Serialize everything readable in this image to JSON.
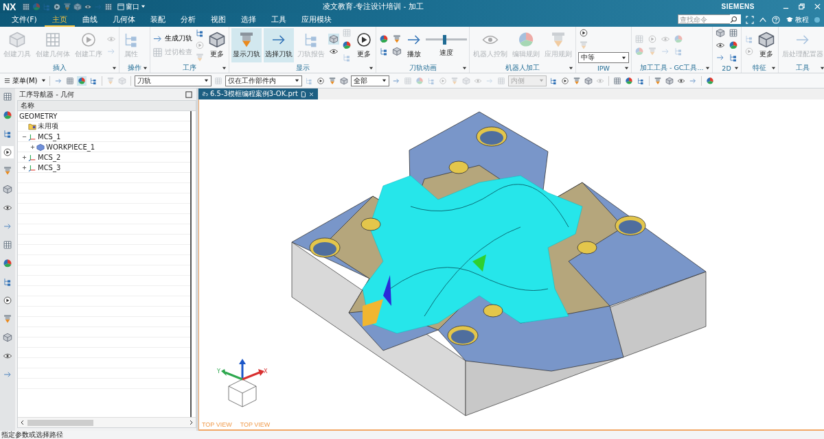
{
  "title_bar": {
    "app": "NX",
    "window_menu": "窗口",
    "title": "凌文教育-专注设计培训 - 加工",
    "brand": "SIEMENS"
  },
  "menu_tabs": [
    {
      "label": "文件(F)",
      "selected": false
    },
    {
      "label": "主页",
      "selected": true
    },
    {
      "label": "曲线",
      "selected": false
    },
    {
      "label": "几何体",
      "selected": false
    },
    {
      "label": "装配",
      "selected": false
    },
    {
      "label": "分析",
      "selected": false
    },
    {
      "label": "视图",
      "selected": false
    },
    {
      "label": "选择",
      "selected": false
    },
    {
      "label": "工具",
      "selected": false
    },
    {
      "label": "应用模块",
      "selected": false
    }
  ],
  "search": {
    "placeholder": "查找命令"
  },
  "help_link": "教程",
  "ribbon": [
    {
      "label": "插入",
      "columns": [
        [
          {
            "kind": "large",
            "label": "创建刀具",
            "disabled": true
          }
        ],
        [
          {
            "kind": "large",
            "label": "创建几何体",
            "disabled": true
          }
        ],
        [
          {
            "kind": "large",
            "label": "创建工序",
            "disabled": true
          }
        ],
        [
          {
            "kind": "icon",
            "disabled": true
          },
          {
            "kind": "icon",
            "disabled": true
          }
        ]
      ]
    },
    {
      "label": "操作",
      "columns": [
        [
          {
            "kind": "large",
            "label": "属性",
            "disabled": true
          }
        ]
      ]
    },
    {
      "label": "工序",
      "columns": [
        [
          {
            "kind": "small",
            "label": "生成刀轨",
            "disabled": false
          },
          {
            "kind": "small",
            "label": "过切检查",
            "disabled": true
          }
        ],
        [
          {
            "kind": "icon",
            "disabled": false
          },
          {
            "kind": "icon",
            "disabled": true
          },
          {
            "kind": "icon",
            "disabled": true
          }
        ],
        [
          {
            "kind": "large",
            "label": "更多",
            "disabled": false
          }
        ]
      ]
    },
    {
      "label": "显示",
      "columns": [
        [
          {
            "kind": "large",
            "label": "显示刀轨",
            "disabled": false,
            "selected": true
          }
        ],
        [
          {
            "kind": "large",
            "label": "选择刀轨",
            "disabled": false,
            "selected": true
          }
        ],
        [
          {
            "kind": "large",
            "label": "刀轨报告",
            "disabled": true
          }
        ],
        [
          {
            "kind": "icon",
            "disabled": false,
            "selected": true
          },
          {
            "kind": "icon",
            "disabled": false
          }
        ],
        [
          {
            "kind": "icon",
            "disabled": true
          },
          {
            "kind": "icon",
            "disabled": false
          },
          {
            "kind": "icon",
            "disabled": true
          }
        ],
        [
          {
            "kind": "large",
            "label": "更多",
            "disabled": false
          }
        ]
      ]
    },
    {
      "label": "刀轨动画",
      "columns": [
        [
          {
            "kind": "icon",
            "disabled": false
          },
          {
            "kind": "icon",
            "disabled": false
          }
        ],
        [
          {
            "kind": "icon",
            "disabled": false
          },
          {
            "kind": "icon",
            "disabled": false
          }
        ],
        [
          {
            "kind": "large",
            "label": "播放",
            "disabled": false
          }
        ],
        [
          {
            "kind": "slider",
            "label": "速度",
            "level": 0.45
          }
        ]
      ]
    },
    {
      "label": "机器人加工",
      "columns": [
        [
          {
            "kind": "large",
            "label": "机器人控制",
            "disabled": true
          }
        ],
        [
          {
            "kind": "large",
            "label": "编辑规则",
            "disabled": true
          }
        ],
        [
          {
            "kind": "large",
            "label": "应用规则",
            "disabled": true
          }
        ]
      ]
    },
    {
      "label": "IPW",
      "columns": [
        [
          {
            "kind": "icon",
            "disabled": false
          },
          {
            "kind": "icon",
            "disabled": true
          },
          {
            "kind": "select",
            "value": "中等"
          }
        ]
      ]
    },
    {
      "label": "加工工具 - GC工具...",
      "columns": [
        [
          {
            "kind": "icon",
            "disabled": true
          },
          {
            "kind": "icon",
            "disabled": true
          }
        ],
        [
          {
            "kind": "icon",
            "disabled": true
          },
          {
            "kind": "icon",
            "disabled": true
          }
        ],
        [
          {
            "kind": "icon",
            "disabled": true
          },
          {
            "kind": "icon",
            "disabled": true
          }
        ],
        [
          {
            "kind": "icon",
            "disabled": true
          },
          {
            "kind": "icon",
            "disabled": true
          }
        ]
      ]
    },
    {
      "label": "2D",
      "columns": [
        [
          {
            "kind": "icon",
            "disabled": false
          },
          {
            "kind": "icon",
            "disabled": false
          },
          {
            "kind": "icon",
            "disabled": false
          }
        ],
        [
          {
            "kind": "icon",
            "disabled": false
          },
          {
            "kind": "icon",
            "disabled": false
          },
          {
            "kind": "icon",
            "disabled": false
          }
        ]
      ]
    },
    {
      "label": "特征",
      "columns": [
        [
          {
            "kind": "icon",
            "disabled": true
          },
          {
            "kind": "icon",
            "disabled": true
          }
        ],
        [
          {
            "kind": "large",
            "label": "更多",
            "disabled": false
          }
        ]
      ]
    },
    {
      "label": "工具",
      "columns": [
        [
          {
            "kind": "large",
            "label": "后处理配置器",
            "disabled": true
          }
        ]
      ]
    }
  ],
  "toolbar": [
    {
      "kind": "menu",
      "label": "菜单(M)"
    },
    {
      "kind": "sep"
    },
    {
      "kind": "icon"
    },
    {
      "kind": "icon"
    },
    {
      "kind": "icon",
      "selected": true
    },
    {
      "kind": "icon"
    },
    {
      "kind": "sep"
    },
    {
      "kind": "icon",
      "disabled": true
    },
    {
      "kind": "icon",
      "disabled": true
    },
    {
      "kind": "sep"
    },
    {
      "kind": "select",
      "value": "刀轨"
    },
    {
      "kind": "icon",
      "disabled": true
    },
    {
      "kind": "select",
      "value": "仅在工作部件内"
    },
    {
      "kind": "icon",
      "disabled": true
    },
    {
      "kind": "icon"
    },
    {
      "kind": "icon"
    },
    {
      "kind": "icon"
    },
    {
      "kind": "select",
      "value": "全部"
    },
    {
      "kind": "icon"
    },
    {
      "kind": "icon",
      "disabled": true
    },
    {
      "kind": "icon",
      "disabled": true
    },
    {
      "kind": "icon",
      "disabled": true
    },
    {
      "kind": "icon",
      "disabled": true
    },
    {
      "kind": "icon",
      "disabled": true
    },
    {
      "kind": "icon",
      "disabled": true
    },
    {
      "kind": "icon",
      "disabled": true
    },
    {
      "kind": "icon",
      "disabled": true
    },
    {
      "kind": "icon",
      "disabled": true
    },
    {
      "kind": "select",
      "value": "内侧",
      "disabled": true
    },
    {
      "kind": "icon"
    },
    {
      "kind": "icon"
    },
    {
      "kind": "icon"
    },
    {
      "kind": "icon"
    },
    {
      "kind": "icon",
      "disabled": true
    },
    {
      "kind": "sep"
    },
    {
      "kind": "icon"
    },
    {
      "kind": "icon"
    },
    {
      "kind": "icon"
    },
    {
      "kind": "sep"
    },
    {
      "kind": "icon"
    },
    {
      "kind": "icon"
    },
    {
      "kind": "icon"
    },
    {
      "kind": "icon"
    },
    {
      "kind": "sep"
    },
    {
      "kind": "icon"
    }
  ],
  "side_tabs": [
    {
      "selected": false
    },
    {
      "selected": false
    },
    {
      "selected": false
    },
    {
      "selected": true
    },
    {
      "selected": false
    },
    {
      "selected": false
    },
    {
      "selected": false
    },
    {
      "selected": false
    },
    {
      "selected": false
    },
    {
      "selected": false
    },
    {
      "selected": false
    },
    {
      "selected": false
    },
    {
      "selected": false
    },
    {
      "selected": false
    },
    {
      "selected": false
    },
    {
      "selected": false
    }
  ],
  "navigator": {
    "title": "工序导航器 - 几何",
    "column": "名称",
    "tree": [
      {
        "label": "GEOMETRY",
        "kind": "root"
      },
      {
        "label": "未用项",
        "kind": "folder"
      },
      {
        "label": "MCS_1",
        "kind": "mcs",
        "expanded": true,
        "children": [
          {
            "label": "WORKPIECE_1",
            "kind": "workpiece",
            "expanded": false
          }
        ]
      },
      {
        "label": "MCS_2",
        "kind": "mcs",
        "expanded": false
      },
      {
        "label": "MCS_3",
        "kind": "mcs",
        "expanded": false
      }
    ]
  },
  "document_tab": {
    "label": "6.5-3模框编程案例3-OK.prt"
  },
  "viewport": {
    "triad_labels": [
      "Y",
      "X"
    ],
    "view_labels": [
      "TOP VIEW",
      "TOP VIEW"
    ]
  },
  "status_bar": "指定参数或选择路径"
}
